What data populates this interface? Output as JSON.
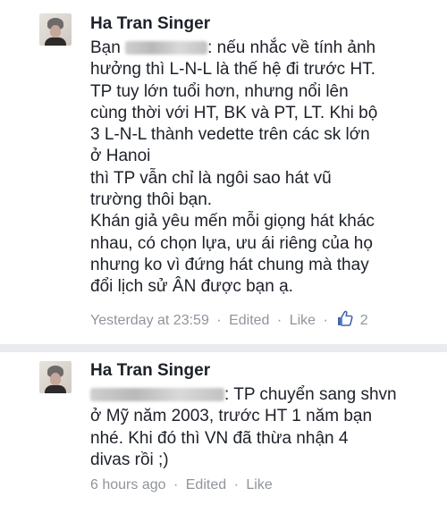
{
  "comments": [
    {
      "author": "Ha Tran Singer",
      "lines": [
        {
          "prefix": "Bạn",
          "text": ": nếu nhắc về tính ảnh"
        },
        {
          "text": "hưởng thì L-N-L là thế hệ đi trước HT."
        },
        {
          "text": "TP tuy lớn tuổi hơn, nhưng nổi lên"
        },
        {
          "text": "cùng thời với HT, BK và PT, LT. Khi bộ"
        },
        {
          "text": "3 L-N-L thành vedette trên các sk lớn"
        },
        {
          "text": "ở Hanoi"
        },
        {
          "text": "thì TP vẫn chỉ là ngôi sao hát vũ"
        },
        {
          "text": "trường thôi bạn."
        },
        {
          "text": "Khán giả yêu mến mỗi giọng hát khác"
        },
        {
          "text": "nhau, có chọn lựa, ưu ái riêng của họ"
        },
        {
          "text": "nhưng ko vì đứng hát chung mà thay"
        },
        {
          "text": "đổi lịch sử ÂN được bạn ạ."
        }
      ],
      "timestamp": "Yesterday at 23:59",
      "edited": "Edited",
      "like": "Like",
      "like_count": "2",
      "separator": "·"
    },
    {
      "author": "Ha Tran Singer",
      "lines": [
        {
          "text": ": TP chuyển sang shvn"
        },
        {
          "text": "ở Mỹ năm 2003, trước HT 1 năm bạn"
        },
        {
          "text": "nhé. Khi đó thì VN đã thừa nhận 4"
        },
        {
          "text": "divas rồi ;)"
        }
      ],
      "timestamp": "6 hours ago",
      "edited": "Edited",
      "like": "Like",
      "separator": "·"
    }
  ],
  "colors": {
    "author": "#1d2129",
    "meta": "#90949c",
    "like_blue": "#4267b2",
    "background": "#e9ebee"
  },
  "icons": {
    "like_icon": "thumbs-up-icon"
  }
}
